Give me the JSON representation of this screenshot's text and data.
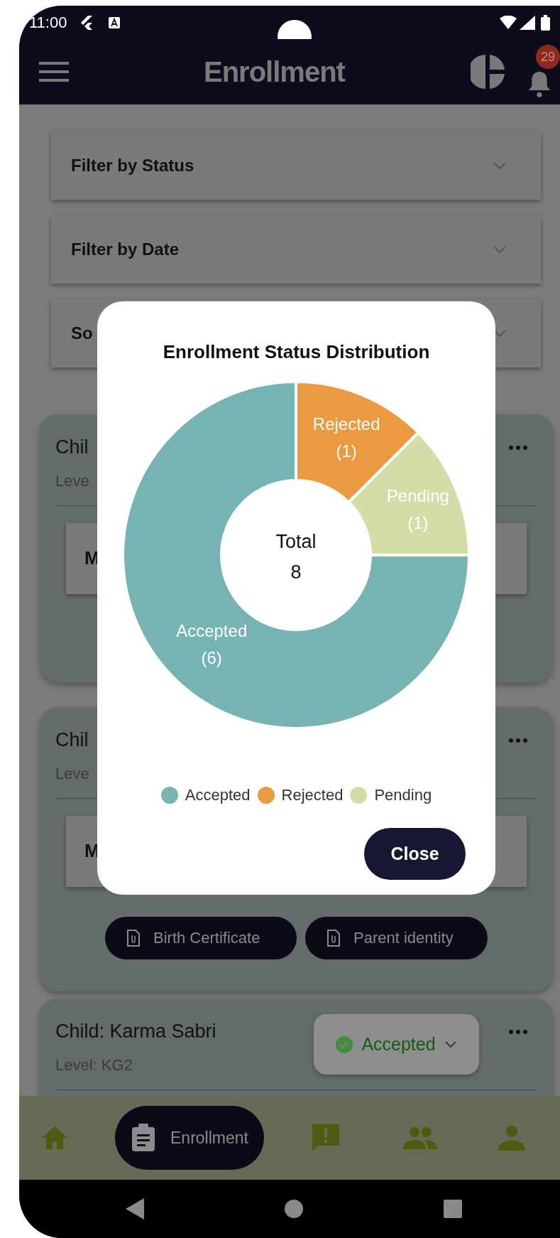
{
  "status_bar": {
    "time": "11:00"
  },
  "app_bar": {
    "title": "Enrollment",
    "notification_count": "29"
  },
  "filters": [
    {
      "label": "Filter by Status"
    },
    {
      "label": "Filter by Date"
    },
    {
      "label": "So"
    }
  ],
  "cards": [
    {
      "child": "Chil",
      "level": "Leve",
      "field": "M"
    },
    {
      "child": "Chil",
      "level": "Leve",
      "field": "M",
      "documents": [
        "Birth Certificate",
        "Parent identity"
      ]
    },
    {
      "child": "Child: Karma Sabri",
      "level": "Level: KG2",
      "status": "Accepted"
    }
  ],
  "dialog": {
    "chart_data": {
      "type": "donut",
      "title": "Enrollment Status Distribution",
      "categories": [
        "Rejected",
        "Pending",
        "Accepted"
      ],
      "values": [
        1,
        1,
        6
      ],
      "value_labels": [
        "(1)",
        "(1)",
        "(6)"
      ]
    },
    "center_label": "Total",
    "center_value": "8",
    "legend": [
      {
        "label": "Accepted",
        "color": "#77b3b2"
      },
      {
        "label": "Rejected",
        "color": "#eb9a42"
      },
      {
        "label": "Pending",
        "color": "#d4dca8"
      }
    ],
    "close_button": "Close"
  },
  "bottom_nav": [
    {
      "selected": false
    },
    {
      "label": "Enrollment",
      "selected": true
    },
    {
      "selected": false
    },
    {
      "selected": false
    },
    {
      "selected": false
    }
  ]
}
